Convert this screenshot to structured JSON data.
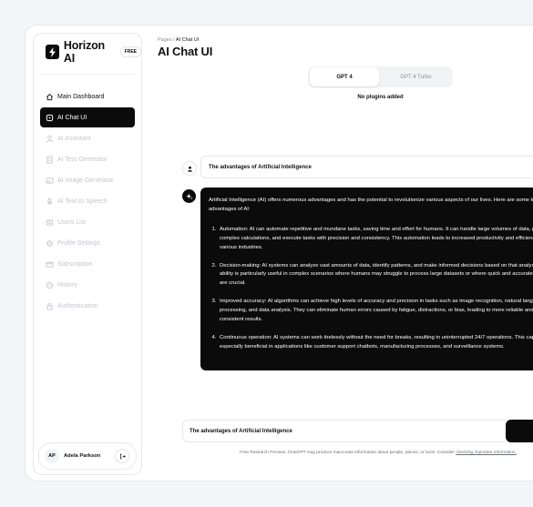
{
  "brand": {
    "name": "Horizon AI",
    "badge": "FREE"
  },
  "sidebar": {
    "items": [
      {
        "label": "Main Dashboard",
        "icon": "home-icon",
        "state": "enabled"
      },
      {
        "label": "AI Chat UI",
        "icon": "chat-icon",
        "state": "active"
      },
      {
        "label": "AI Assistant",
        "icon": "assistant-icon",
        "state": "disabled"
      },
      {
        "label": "AI Text Generator",
        "icon": "document-icon",
        "state": "disabled"
      },
      {
        "label": "AI Image Generator",
        "icon": "image-icon",
        "state": "disabled"
      },
      {
        "label": "AI Text to Speech",
        "icon": "microphone-icon",
        "state": "disabled"
      },
      {
        "label": "Users List",
        "icon": "users-icon",
        "state": "disabled"
      },
      {
        "label": "Profile Settings",
        "icon": "gear-icon",
        "state": "disabled"
      },
      {
        "label": "Subscription",
        "icon": "card-icon",
        "state": "disabled"
      },
      {
        "label": "History",
        "icon": "clock-icon",
        "state": "disabled"
      },
      {
        "label": "Authentication",
        "icon": "lock-icon",
        "state": "disabled"
      }
    ]
  },
  "user": {
    "initials": "AP",
    "name": "Adela Parkson"
  },
  "breadcrumb": {
    "root": "Pages",
    "separator": "/",
    "current": "AI Chat UI"
  },
  "page_title": "AI Chat UI",
  "models": {
    "tabs": [
      "GPT 4",
      "GPT 4 Turbo"
    ],
    "selected": "GPT 4"
  },
  "plugins_text": "No plugins added",
  "chat": {
    "user_message": "The advantages of Artificial Intelligence",
    "ai_intro": "Artificial Intelligence (AI) offers numerous advantages and has the potential to revolutionize various aspects of our lives. Here are some key advantages of AI:",
    "ai_points": [
      "Automation: AI can automate repetitive and mundane tasks, saving time and effort for humans. It can handle large volumes of data, perform complex calculations, and execute tasks with precision and consistency. This automation leads to increased productivity and efficiency in various industries.",
      "Decision-making: AI systems can analyze vast amounts of data, identify patterns, and make informed decisions based on that analysis. This ability is particularly useful in complex scenarios where humans may struggle to process large datasets or where quick and accurate decisions are crucial.",
      "Improved accuracy: AI algorithms can achieve high levels of accuracy and precision in tasks such as image recognition, natural language processing, and data analysis. They can eliminate human errors caused by fatigue, distractions, or bias, leading to more reliable and consistent results.",
      "Continuous operation: AI systems can work tirelessly without the need for breaks, resulting in uninterrupted 24/7 operations. This capability is especially beneficial in applications like customer support chatbots, manufacturing processes, and surveillance systems."
    ]
  },
  "input": {
    "value": "The advantages of Artificial Intelligence"
  },
  "disclaimer": {
    "prefix": "Free Research Preview. ChatGPT may produce inaccurate information about people, places, or facts. Consider ",
    "link": "checking important information."
  },
  "colors": {
    "accent": "#0b0b0b",
    "muted": "#c3c6cd",
    "background": "#f4f5f8"
  }
}
